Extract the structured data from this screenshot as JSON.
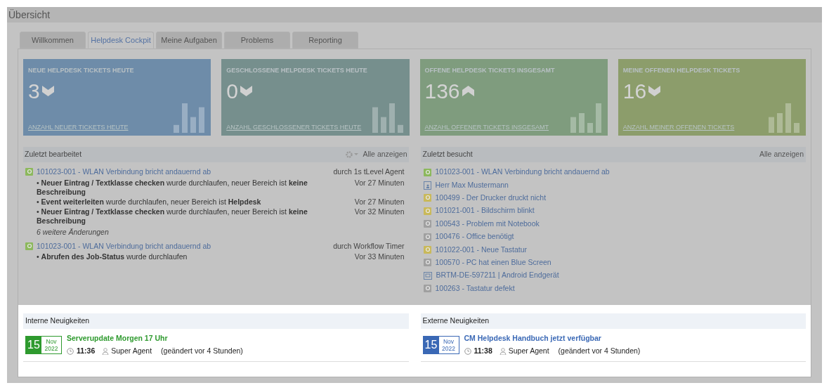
{
  "page_title": "Übersicht",
  "tabs": [
    {
      "label": "Willkommen",
      "selected": false
    },
    {
      "label": "Helpdesk Cockpit",
      "selected": true
    },
    {
      "label": "Meine Aufgaben",
      "selected": false
    },
    {
      "label": "Problems",
      "selected": false
    },
    {
      "label": "Reporting",
      "selected": false
    }
  ],
  "cards": [
    {
      "title": "NEUE HELPDESK TICKETS HEUTE",
      "value": "3",
      "rising": false,
      "link": "ANZAHL NEUER TICKETS HEUTE",
      "color": "#6e8ca9"
    },
    {
      "title": "GESCHLOSSENE HELPDESK TICKETS HEUTE",
      "value": "0",
      "rising": false,
      "link": "ANZAHL GESCHLOSSENER TICKETS HEUTE",
      "color": "#768f8d"
    },
    {
      "title": "OFFENE HELPDESK TICKETS INSGESAMT",
      "value": "136",
      "rising": true,
      "link": "ANZAHL OFFENER TICKETS INSGESAMT",
      "color": "#7f9c7e"
    },
    {
      "title": "MEINE OFFENEN HELPDESK TICKETS",
      "value": "16",
      "rising": false,
      "link": "ANZAHL MEINER OFFENEN TICKETS",
      "color": "#8c9d6b"
    }
  ],
  "recently_edited": {
    "title": "Zuletzt bearbeitet",
    "show_all": "Alle anzeigen",
    "entries": [
      {
        "title": "101023-001 - WLAN Verbindung bricht andauernd ab",
        "by": "durch 1s tLevel Agent",
        "changes": [
          {
            "text": "• **Neuer Eintrag / Textklasse checken** wurde durchlaufen, neuer Bereich ist **keine Beschreibung**",
            "time": "Vor 27 Minuten"
          },
          {
            "text": "• **Event weiterleiten** wurde durchlaufen, neuer Bereich ist **Helpdesk**",
            "time": "Vor 27 Minuten"
          },
          {
            "text": "• **Neuer Eintrag / Textklasse checken** wurde durchlaufen, neuer Bereich ist **keine Beschreibung**",
            "time": "Vor 32 Minuten"
          }
        ],
        "more": "6 weitere Änderungen"
      },
      {
        "title": "101023-001 - WLAN Verbindung bricht andauernd ab",
        "by": "durch Workflow Timer",
        "changes": [
          {
            "text": "• **Abrufen des Job-Status** wurde durchlaufen",
            "time": "Vor 33 Minuten"
          }
        ]
      }
    ]
  },
  "recently_visited": {
    "title": "Zuletzt besucht",
    "show_all": "Alle anzeigen",
    "items": [
      {
        "kind": "ticket",
        "color": "#8cb85c",
        "label": "101023-001 - WLAN Verbindung bricht andauernd ab"
      },
      {
        "kind": "contact",
        "label": "Herr Max Mustermann"
      },
      {
        "kind": "ticket",
        "color": "#c9b95a",
        "label": "100499 - Der Drucker druckt nicht"
      },
      {
        "kind": "ticket",
        "color": "#c9b95a",
        "label": "101021-001 - Bildschirm blinkt"
      },
      {
        "kind": "ticket",
        "color": "#a0a0a0",
        "label": "100543 - Problem mit Notebook"
      },
      {
        "kind": "ticket",
        "color": "#a0a0a0",
        "label": "100476 - Office benötigt"
      },
      {
        "kind": "ticket",
        "color": "#c9b95a",
        "label": "101022-001 - Neue Tastatur"
      },
      {
        "kind": "ticket",
        "color": "#a0a0a0",
        "label": "100570 - PC hat einen Blue Screen"
      },
      {
        "kind": "device",
        "label": "BRTM-DE-597211 | Android Endgerät"
      },
      {
        "kind": "ticket",
        "color": "#a0a0a0",
        "label": "100263 - Tastatur defekt"
      }
    ]
  },
  "news": [
    {
      "title": "Interne Neuigkeiten",
      "items": [
        {
          "day": "15",
          "month": "Nov",
          "year": "2022",
          "color": "#2e9a2e",
          "headline": "Serverupdate Morgen 17 Uhr",
          "time": "11:36",
          "author": "Super Agent",
          "changed": "(geändert vor 4 Stunden)"
        }
      ]
    },
    {
      "title": "Externe Neuigkeiten",
      "items": [
        {
          "day": "15",
          "month": "Nov",
          "year": "2022",
          "color": "#3a68b5",
          "headline": "CM Helpdesk Handbuch jetzt verfügbar",
          "time": "11:38",
          "author": "Super Agent",
          "changed": "(geändert vor 4 Stunden)"
        }
      ]
    }
  ]
}
